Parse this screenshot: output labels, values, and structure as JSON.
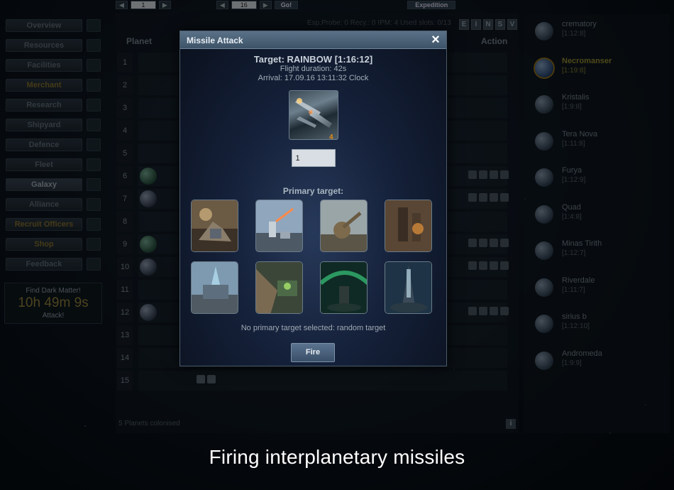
{
  "topbar": {
    "galaxy_value": "1",
    "system_value": "16",
    "go_label": "Go!",
    "expedition_label": "Expedition"
  },
  "menu": {
    "items": [
      {
        "label": "Overview",
        "style": "normal"
      },
      {
        "label": "Resources",
        "style": "normal"
      },
      {
        "label": "Facilities",
        "style": "normal"
      },
      {
        "label": "Merchant",
        "style": "highlight"
      },
      {
        "label": "Research",
        "style": "normal"
      },
      {
        "label": "Shipyard",
        "style": "normal"
      },
      {
        "label": "Defence",
        "style": "normal"
      },
      {
        "label": "Fleet",
        "style": "normal"
      },
      {
        "label": "Galaxy",
        "style": "active"
      },
      {
        "label": "Alliance",
        "style": "normal"
      },
      {
        "label": "Recruit Officers",
        "style": "highlight"
      },
      {
        "label": "Shop",
        "style": "highlight"
      },
      {
        "label": "Feedback",
        "style": "normal"
      }
    ],
    "dark_matter": {
      "label": "Find Dark Matter!",
      "timer": "10h 49m 9s",
      "action": "Attack!"
    }
  },
  "galaxy": {
    "info": "Esp.Probe: 0   Recy.: 0   IPM: 4   Used slots: 0/13",
    "filters": [
      "E",
      "I",
      "N",
      "S",
      "V"
    ],
    "col_planet": "Planet",
    "col_action": "Action",
    "rows": [
      "1",
      "2",
      "3",
      "4",
      "5",
      "6",
      "7",
      "8",
      "9",
      "10",
      "11",
      "12",
      "13",
      "14",
      "15"
    ],
    "colonised": "5 Planets colonised",
    "info_icon": "i"
  },
  "friends": [
    {
      "name": "crematory",
      "coords": "[1:12:8]",
      "current": false
    },
    {
      "name": "Necromanser",
      "coords": "[1:19:8]",
      "current": true
    },
    {
      "name": "Kristalis",
      "coords": "[1:9:8]",
      "current": false
    },
    {
      "name": "Tera Nova",
      "coords": "[1:11:8]",
      "current": false
    },
    {
      "name": "Furya",
      "coords": "[1:12:9]",
      "current": false
    },
    {
      "name": "Quad",
      "coords": "[1:4:8]",
      "current": false
    },
    {
      "name": "Minas Tirith",
      "coords": "[1:12:7]",
      "current": false
    },
    {
      "name": "Riverdale",
      "coords": "[1:11:7]",
      "current": false
    },
    {
      "name": "sirius b",
      "coords": "[1:12:10]",
      "current": false
    },
    {
      "name": "Andromeda",
      "coords": "[1:9:9]",
      "current": false
    }
  ],
  "modal": {
    "title": "Missile Attack",
    "close_icon": "×",
    "target": "Target: RAINBOW [1:16:12]",
    "flight_duration": "Flight duration: 42s",
    "arrival": "Arrival: 17.09.16 13:11:32 Clock",
    "missile_count": "4",
    "quantity": "1",
    "primary_label": "Primary target:",
    "targets": [
      {
        "icon": "rocket-launcher-icon"
      },
      {
        "icon": "light-laser-icon"
      },
      {
        "icon": "heavy-laser-icon"
      },
      {
        "icon": "gauss-cannon-icon"
      },
      {
        "icon": "ion-cannon-icon"
      },
      {
        "icon": "plasma-turret-icon"
      },
      {
        "icon": "small-shield-dome-icon"
      },
      {
        "icon": "large-shield-dome-icon"
      }
    ],
    "note": "No primary target selected: random target",
    "fire_label": "Fire"
  },
  "caption": "Firing interplanetary missiles",
  "colors": {
    "accent": "#e08a1a",
    "modal_header": "#4a6177",
    "highlight_text": "#8f8530"
  }
}
